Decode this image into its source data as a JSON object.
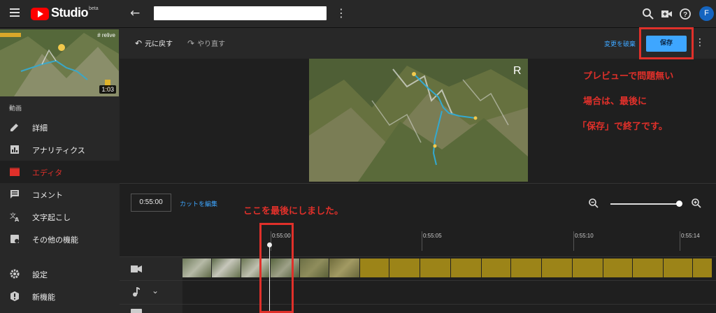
{
  "topbar": {
    "brand": "Studio",
    "beta": "beta",
    "avatar_letter": "F"
  },
  "sidebar": {
    "thumb_duration": "1:03",
    "thumb_watermark": "# relive",
    "section_label": "動画",
    "items": [
      {
        "label": "詳細",
        "icon": "pencil-icon"
      },
      {
        "label": "アナリティクス",
        "icon": "analytics-icon"
      },
      {
        "label": "エディタ",
        "icon": "editor-icon",
        "active": true
      },
      {
        "label": "コメント",
        "icon": "comment-icon"
      },
      {
        "label": "文字起こし",
        "icon": "translate-icon"
      },
      {
        "label": "その他の機能",
        "icon": "more-features-icon"
      },
      {
        "label": "設定",
        "icon": "gear-icon"
      },
      {
        "label": "新機能",
        "icon": "alert-icon"
      }
    ]
  },
  "toolbar": {
    "undo_label": "元に戻す",
    "redo_label": "やり直す",
    "discard_label": "変更を破棄",
    "save_label": "保存"
  },
  "timeline": {
    "current_time": "0:55:00",
    "cut_label": "カットを編集",
    "ticks": [
      "0:55:00",
      "0:55:05",
      "0:55:10",
      "0:55:14"
    ]
  },
  "annotations": {
    "right_line1": "プレビューで問題無い",
    "right_line2": "場合は、最後に",
    "right_line3": "「保存」で終了です。",
    "mid": "ここを最後にしました。"
  },
  "colors": {
    "accent_blue": "#3ea6ff",
    "annotation_red": "#e0302a",
    "active_red": "#e0302a"
  }
}
